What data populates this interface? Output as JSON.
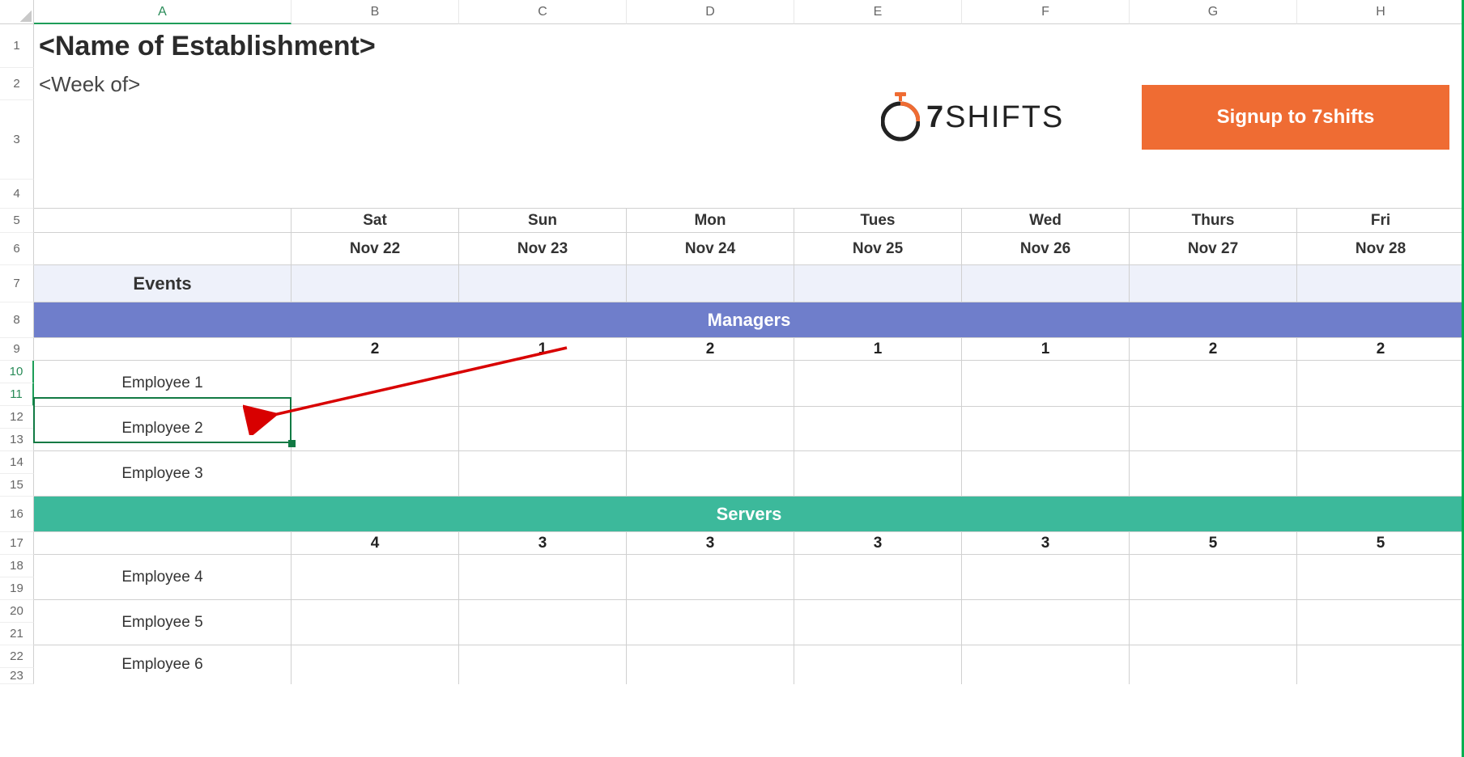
{
  "columns": [
    "A",
    "B",
    "C",
    "D",
    "E",
    "F",
    "G",
    "H"
  ],
  "current_column": "A",
  "title": "<Name of Establishment>",
  "subtitle": "<Week of>",
  "logo_brand": "7SHIFTS",
  "cta_label": "Signup to 7shifts",
  "day_labels": [
    "Sat",
    "Sun",
    "Mon",
    "Tues",
    "Wed",
    "Thurs",
    "Fri"
  ],
  "date_labels": [
    "Nov 22",
    "Nov 23",
    "Nov 24",
    "Nov 25",
    "Nov 26",
    "Nov 27",
    "Nov 28"
  ],
  "events_label": "Events",
  "sections": {
    "managers": {
      "label": "Managers",
      "counts": [
        "2",
        "1",
        "2",
        "1",
        "1",
        "2",
        "2"
      ],
      "employees": [
        "Employee 1",
        "Employee 2",
        "Employee 3"
      ]
    },
    "servers": {
      "label": "Servers",
      "counts": [
        "4",
        "3",
        "3",
        "3",
        "3",
        "5",
        "5"
      ],
      "employees": [
        "Employee 4",
        "Employee 5",
        "Employee 6"
      ]
    }
  },
  "selected_range": "A10:A11",
  "colors": {
    "managers_banner": "#6f7ecb",
    "servers_banner": "#3cb99b",
    "cta": "#ef6c33",
    "selection": "#127a44"
  }
}
